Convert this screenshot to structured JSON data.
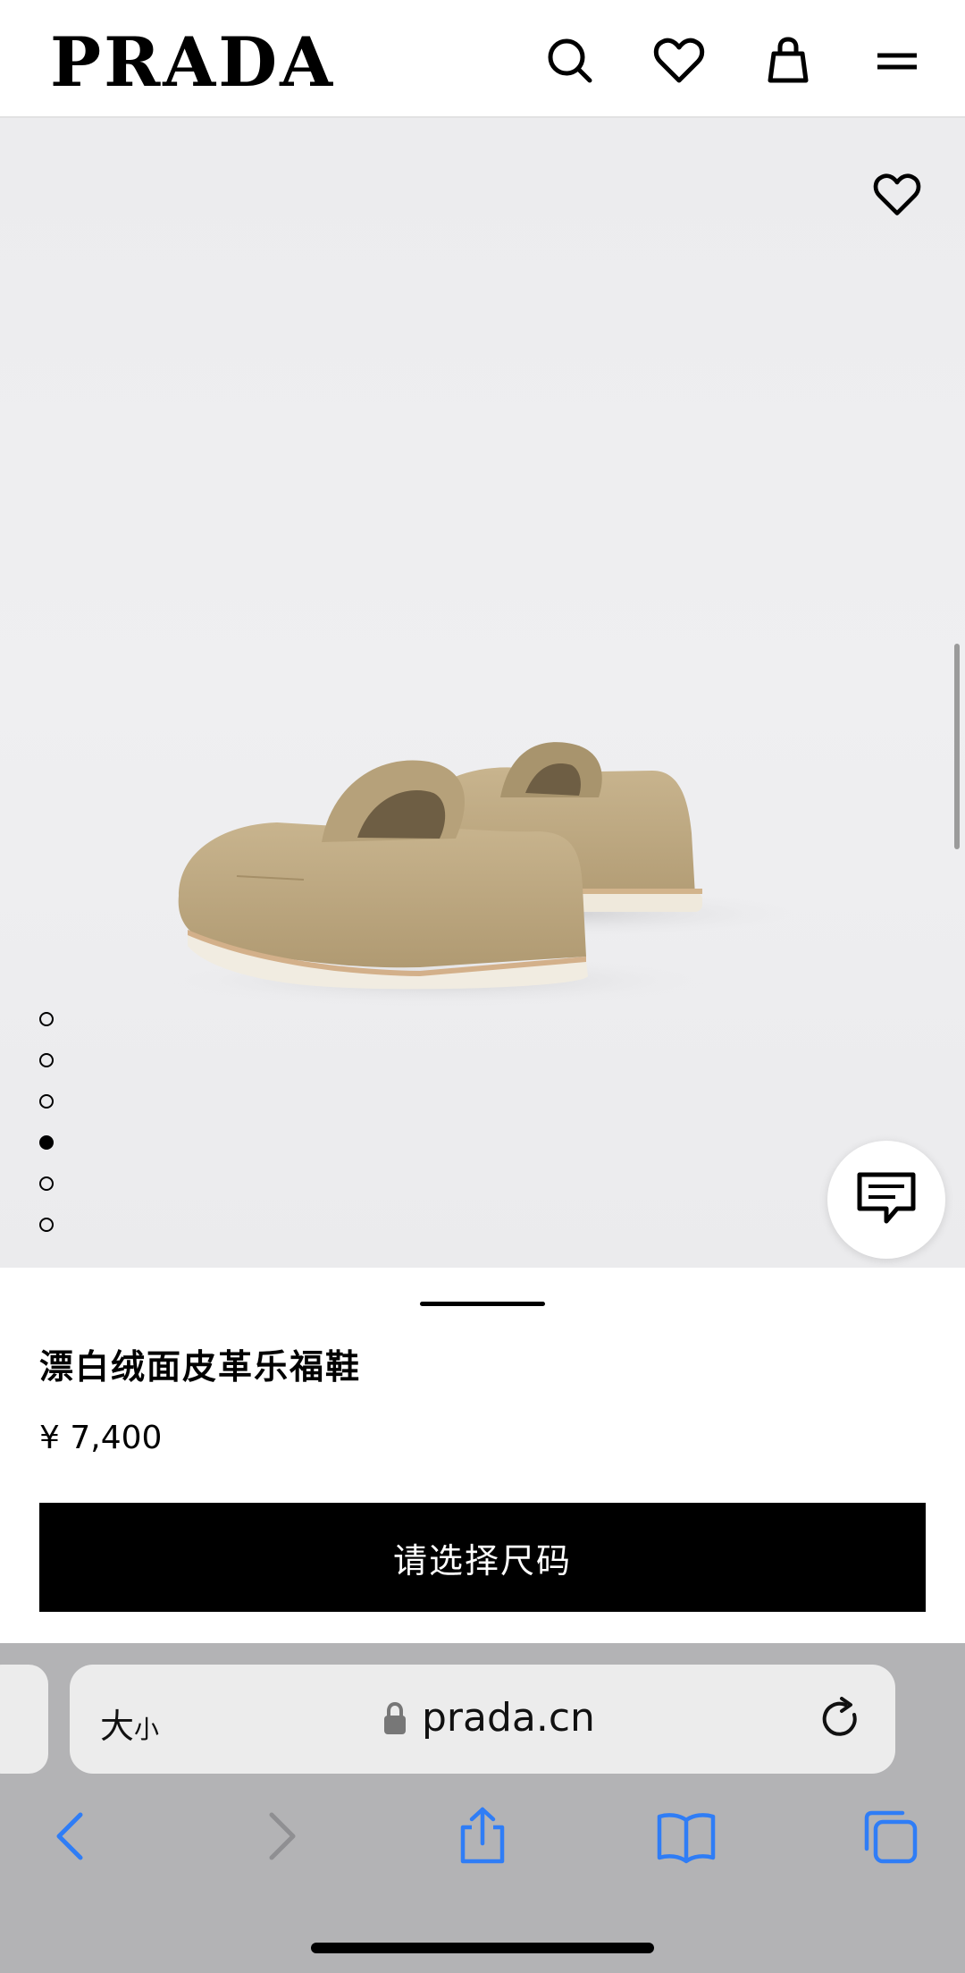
{
  "header": {
    "logo": "PRADA",
    "icons": [
      "search-icon",
      "heart-icon",
      "bag-icon",
      "menu-icon"
    ]
  },
  "gallery": {
    "image_count": 6,
    "active_index": 4,
    "favorite_icon": "heart-icon",
    "chat_icon": "chat-icon"
  },
  "product": {
    "name": "漂白绒面皮革乐福鞋",
    "price": "¥ 7,400",
    "cta_label": "请选择尺码"
  },
  "browser": {
    "text_size_big": "大",
    "text_size_small": "小",
    "url": "prada.cn",
    "toolbar_icons": [
      "back-icon",
      "forward-icon",
      "share-icon",
      "bookmarks-icon",
      "tabs-icon"
    ]
  },
  "colors": {
    "brand": "#000000",
    "cta_text": "#ffffff",
    "browser_bar": "#b3b3b5",
    "ios_blue": "#3b82f6"
  }
}
